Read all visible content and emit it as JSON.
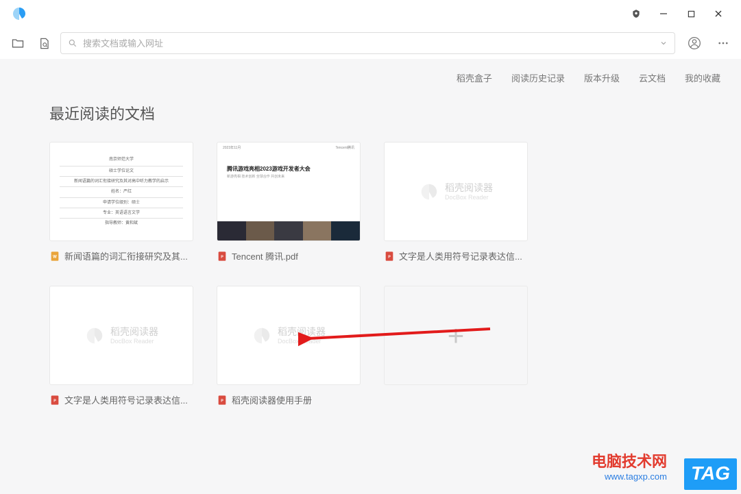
{
  "search": {
    "placeholder": "搜索文档或输入网址"
  },
  "tabs": [
    "稻壳盒子",
    "阅读历史记录",
    "版本升级",
    "云文档",
    "我的收藏"
  ],
  "section_title": "最近阅读的文档",
  "docs": [
    {
      "title": "新闻语篇的词汇衔接研究及其...",
      "type": "doc",
      "thumb_lines": [
        "南京师范大学",
        "硕士学位论文",
        "新闻语篇的词汇衔接研究及其对高中听力教学的启示",
        "姓名：严红",
        "申请学位级别：硕士",
        "专业：英语语言文学",
        "指导教师：黄和斌"
      ]
    },
    {
      "title": "Tencent 腾讯.pdf",
      "type": "pdf",
      "thumb_date": "2023年11月",
      "thumb_brand": "Tencent腾讯",
      "thumb_headline": "腾讯游戏亮相2023游戏开发者大会"
    },
    {
      "title": "文字是人类用符号记录表达信...",
      "type": "pdf",
      "placeholder": true
    },
    {
      "title": "文字是人类用符号记录表达信...",
      "type": "pdf",
      "placeholder": true
    },
    {
      "title": "稻壳阅读器使用手册",
      "type": "pdf",
      "placeholder": true
    }
  ],
  "placeholder_brand": {
    "cn": "稻壳阅读器",
    "en": "DocBox Reader"
  },
  "watermark": {
    "line1": "电脑技术网",
    "line2": "www.tagxp.com",
    "tag": "TAG"
  }
}
